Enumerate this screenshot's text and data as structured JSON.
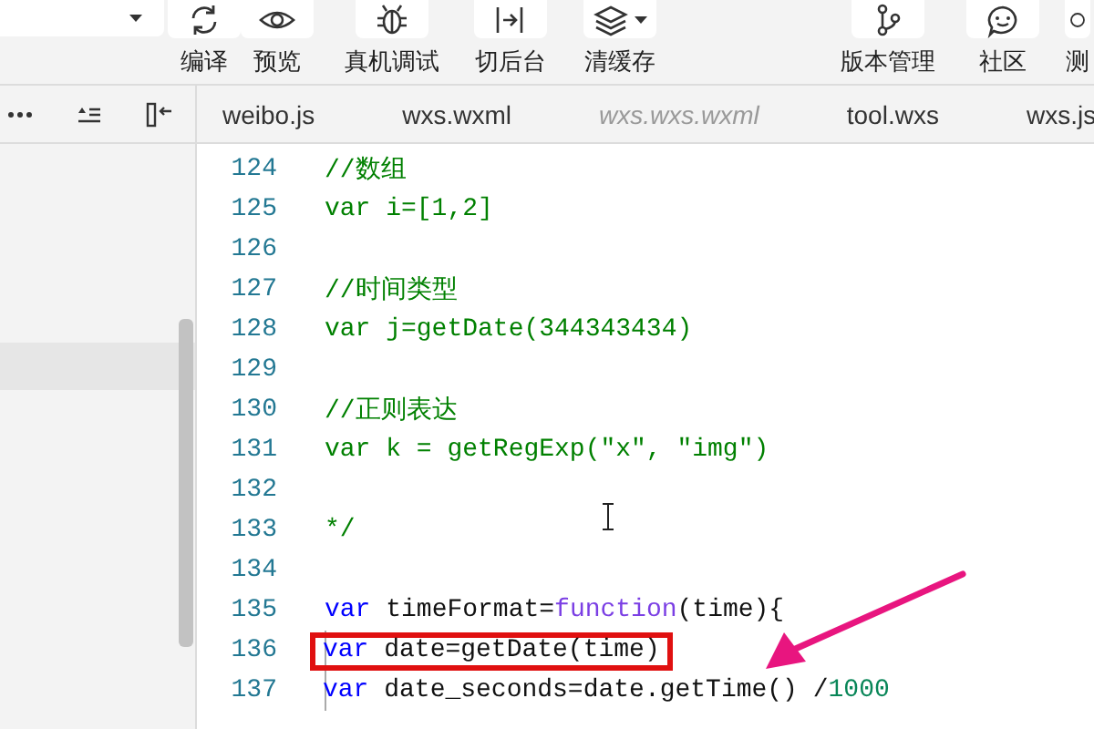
{
  "toolbar": {
    "left_buttons": [
      {
        "label": "编译",
        "has_menu": false
      },
      {
        "label": "预览",
        "has_menu": false
      },
      {
        "label": "真机调试",
        "has_menu": false
      },
      {
        "label": "切后台",
        "has_menu": false
      },
      {
        "label": "清缓存",
        "has_menu": true
      }
    ],
    "right_buttons": [
      {
        "label": "版本管理",
        "has_menu": false
      },
      {
        "label": "社区",
        "has_menu": false
      },
      {
        "label": "测",
        "has_menu": false
      }
    ]
  },
  "tabs": [
    {
      "label": "weibo.js",
      "preview": false
    },
    {
      "label": "wxs.wxml",
      "preview": false
    },
    {
      "label": "wxs.wxs.wxml",
      "preview": true
    },
    {
      "label": "tool.wxs",
      "preview": false
    },
    {
      "label": "wxs.js",
      "preview": false
    }
  ],
  "editor": {
    "lines": [
      {
        "number": "124",
        "annotated": false,
        "tokens": [
          {
            "kind": "comment",
            "text": "//数组"
          }
        ]
      },
      {
        "number": "125",
        "annotated": false,
        "tokens": [
          {
            "kind": "comment",
            "text": "var i=[1,2]"
          }
        ]
      },
      {
        "number": "126",
        "annotated": false
      },
      {
        "number": "127",
        "annotated": false,
        "tokens": [
          {
            "kind": "comment",
            "text": "//时间类型"
          }
        ]
      },
      {
        "number": "128",
        "annotated": false,
        "tokens": [
          {
            "kind": "comment",
            "text": "var j=getDate(344343434)"
          }
        ]
      },
      {
        "number": "129",
        "annotated": false
      },
      {
        "number": "130",
        "annotated": false,
        "tokens": [
          {
            "kind": "comment",
            "text": "//正则表达"
          }
        ]
      },
      {
        "number": "131",
        "annotated": false,
        "tokens": [
          {
            "kind": "comment",
            "text": "var k = getRegExp(\"x\", \"img\")"
          }
        ]
      },
      {
        "number": "132",
        "annotated": false
      },
      {
        "number": "133",
        "annotated": false,
        "tokens": [
          {
            "kind": "comment",
            "text": "*/"
          }
        ]
      },
      {
        "number": "134",
        "annotated": false
      },
      {
        "number": "135",
        "annotated": false,
        "tokens": [
          {
            "kind": "keyword",
            "text": "var"
          },
          {
            "kind": "plain",
            "text": " timeFormat="
          },
          {
            "kind": "function",
            "text": "function"
          },
          {
            "kind": "plain",
            "text": "(time){"
          }
        ],
        "children": [
          {
            "number": "136",
            "annotated": true,
            "tokens": [
              {
                "kind": "keyword",
                "text": "var"
              },
              {
                "kind": "plain",
                "text": " date=getDate(time)"
              }
            ]
          },
          {
            "number": "137",
            "annotated": false,
            "tokens": [
              {
                "kind": "keyword",
                "text": "var"
              },
              {
                "kind": "plain",
                "text": " date_seconds=date.getTime() /"
              },
              {
                "kind": "number",
                "text": "1000"
              }
            ]
          }
        ]
      }
    ]
  }
}
